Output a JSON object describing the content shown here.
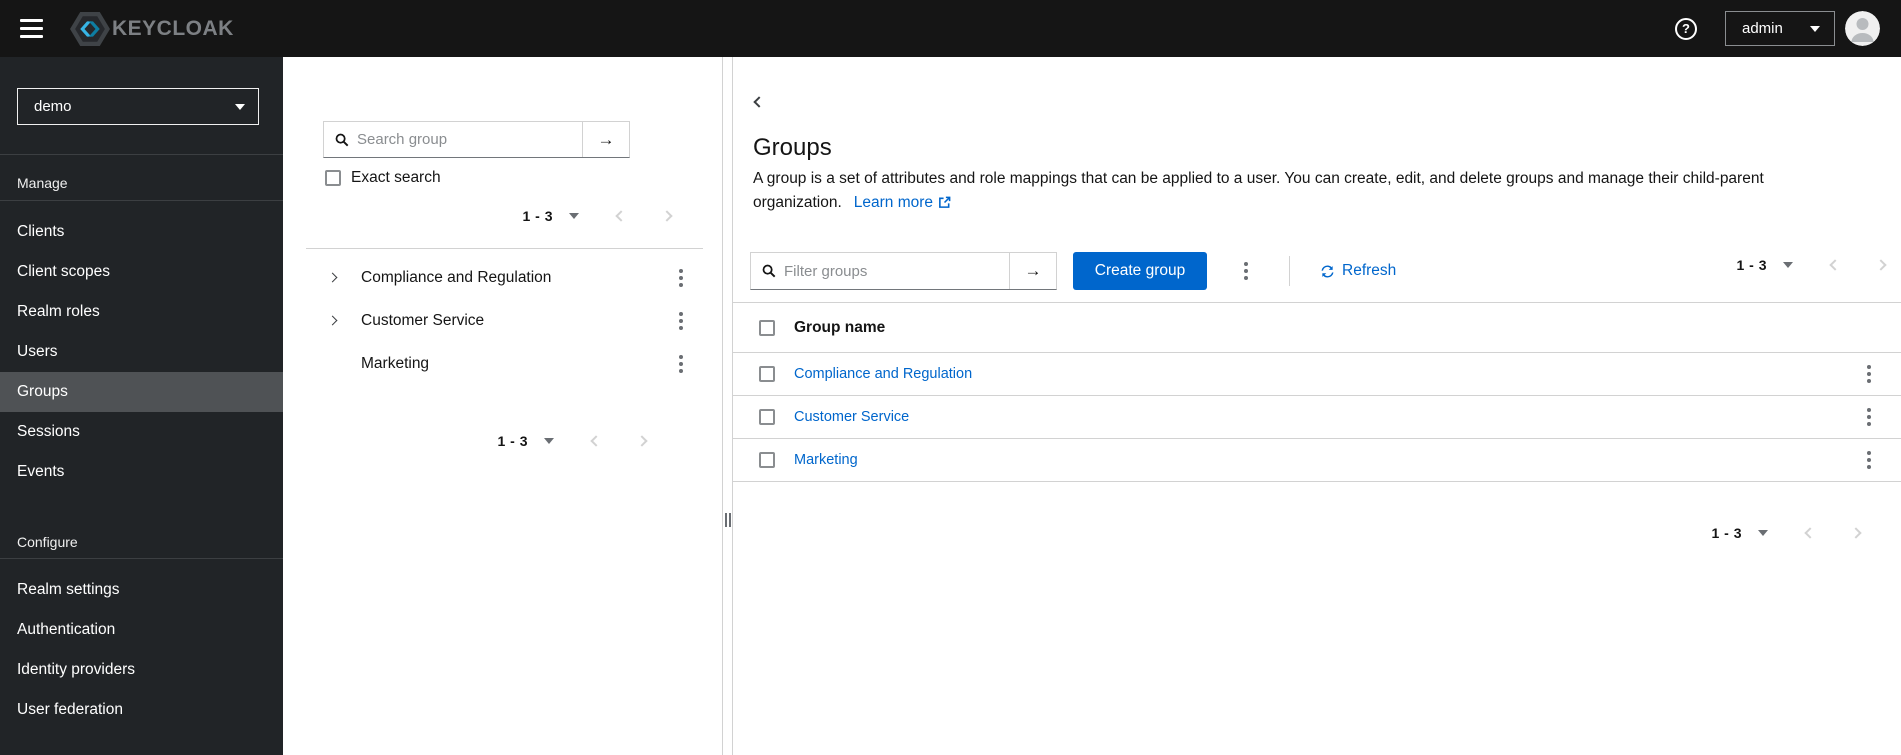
{
  "topbar": {
    "brand_text": "KEYCLOAK",
    "help_glyph": "?",
    "user": "admin"
  },
  "sidebar": {
    "realm": "demo",
    "manage_label": "Manage",
    "manage_items": [
      "Clients",
      "Client scopes",
      "Realm roles",
      "Users",
      "Groups",
      "Sessions",
      "Events"
    ],
    "active_item": "Groups",
    "configure_label": "Configure",
    "configure_items": [
      "Realm settings",
      "Authentication",
      "Identity providers",
      "User federation"
    ]
  },
  "tree_panel": {
    "search_placeholder": "Search group",
    "exact_search_label": "Exact search",
    "pagination_range": "1 - 3",
    "groups": [
      {
        "name": "Compliance and Regulation",
        "expandable": true
      },
      {
        "name": "Customer Service",
        "expandable": true
      },
      {
        "name": "Marketing",
        "expandable": false
      }
    ]
  },
  "main": {
    "title": "Groups",
    "description": "A group is a set of attributes and role mappings that can be applied to a user. You can create, edit, and delete groups and manage their child-parent organization.",
    "learn_more_label": "Learn more",
    "filter_placeholder": "Filter groups",
    "create_button_label": "Create group",
    "refresh_label": "Refresh",
    "pagination_range": "1 - 3",
    "table_header": "Group name",
    "rows": [
      "Compliance and Regulation",
      "Customer Service",
      "Marketing"
    ]
  },
  "icons": {
    "arrow_right": "→"
  },
  "colors": {
    "primary": "#0066cc",
    "masthead": "#151515",
    "sidebar": "#212427",
    "sidebar_active": "#4f5255",
    "link": "#0066cc"
  }
}
